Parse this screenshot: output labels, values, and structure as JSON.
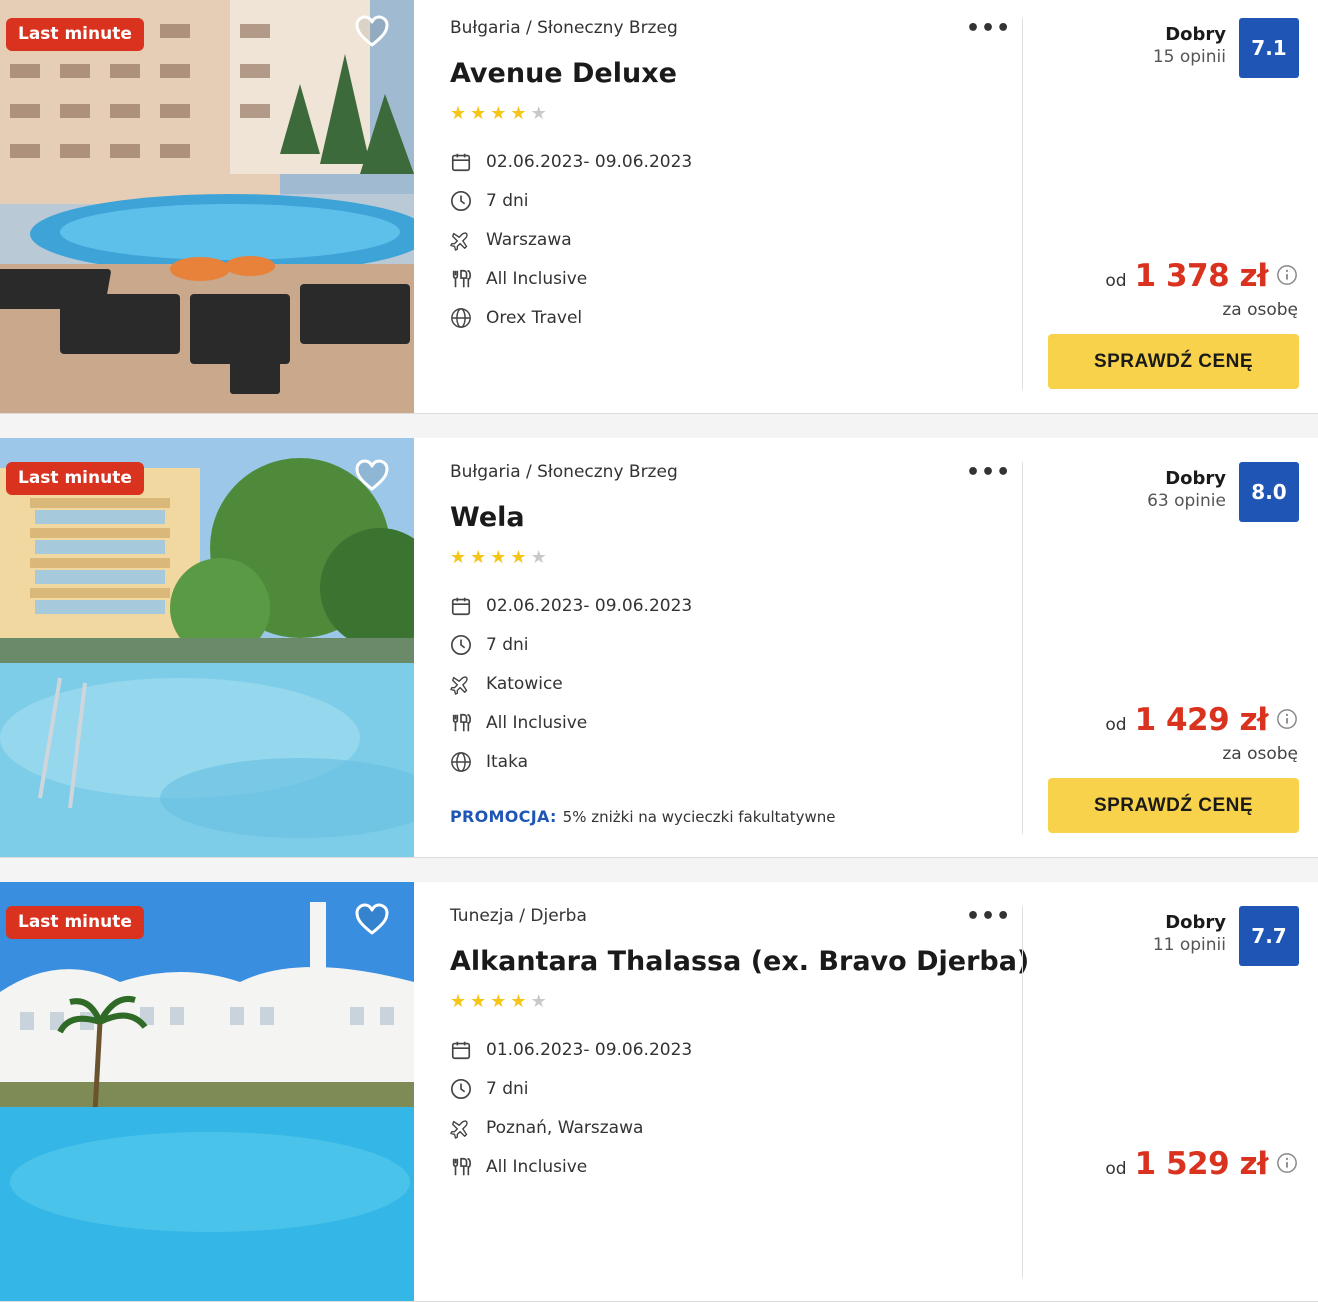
{
  "colors": {
    "badge": "#d9321f",
    "score": "#1f56b5",
    "price": "#d9321f",
    "cta": "#f7d24a",
    "promo": "#1f56b5",
    "star_on": "#f5c518",
    "star_off": "#c9c9c9"
  },
  "offers": [
    {
      "badge": "Last minute",
      "location": "Bułgaria / Słoneczny Brzeg",
      "name": "Avenue Deluxe",
      "stars": 4,
      "dates": "02.06.2023- 09.06.2023",
      "duration": "7 dni",
      "departure": "Warszawa",
      "board": "All Inclusive",
      "operator": "Orex Travel",
      "rating_word": "Dobry",
      "rating_count": "15 opinii",
      "score": "7.1",
      "price_prefix": "od",
      "price": "1 378 zł",
      "price_note": "za osobę",
      "cta": "SPRAWDŹ CENĘ"
    },
    {
      "badge": "Last minute",
      "location": "Bułgaria / Słoneczny Brzeg",
      "name": "Wela",
      "stars": 4,
      "dates": "02.06.2023- 09.06.2023",
      "duration": "7 dni",
      "departure": "Katowice",
      "board": "All Inclusive",
      "operator": "Itaka",
      "promo_label": "PROMOCJA:",
      "promo_text": "5% zniżki na wycieczki fakultatywne",
      "rating_word": "Dobry",
      "rating_count": "63 opinie",
      "score": "8.0",
      "price_prefix": "od",
      "price": "1 429 zł",
      "price_note": "za osobę",
      "cta": "SPRAWDŹ CENĘ"
    },
    {
      "badge": "Last minute",
      "location": "Tunezja / Djerba",
      "name": "Alkantara Thalassa (ex. Bravo Djerba)",
      "stars": 4,
      "dates": "01.06.2023- 09.06.2023",
      "duration": "7 dni",
      "departure": "Poznań, Warszawa",
      "board": "All Inclusive",
      "rating_word": "Dobry",
      "rating_count": "11 opinii",
      "score": "7.7",
      "price_prefix": "od",
      "price": "1 529 zł"
    }
  ],
  "icons": {
    "favorite": "heart-icon",
    "more": "more-dots-icon",
    "dates": "calendar-icon",
    "duration": "clock-icon",
    "departure": "plane-icon",
    "board": "cutlery-icon",
    "operator": "globe-icon",
    "price_info": "info-icon"
  }
}
